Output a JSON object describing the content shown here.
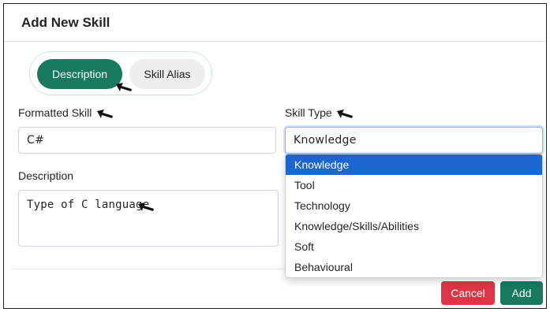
{
  "modal": {
    "title": "Add New Skill"
  },
  "tabs": [
    {
      "label": "Description",
      "active": true
    },
    {
      "label": "Skill Alias",
      "active": false
    }
  ],
  "form": {
    "formatted_skill": {
      "label": "Formatted Skill",
      "value": "C#"
    },
    "skill_type": {
      "label": "Skill Type",
      "value": "Knowledge"
    },
    "description": {
      "label": "Description",
      "value": "Type of C language"
    }
  },
  "dropdown": {
    "options": [
      "Knowledge",
      "Tool",
      "Technology",
      "Knowledge/Skills/Abilities",
      "Soft",
      "Behavioural"
    ],
    "selected": "Knowledge"
  },
  "footer": {
    "cancel_label": "Cancel",
    "add_label": "Add"
  },
  "colors": {
    "primary": "#177a5e",
    "danger": "#dc3545",
    "option_highlight": "#1b66d1"
  }
}
